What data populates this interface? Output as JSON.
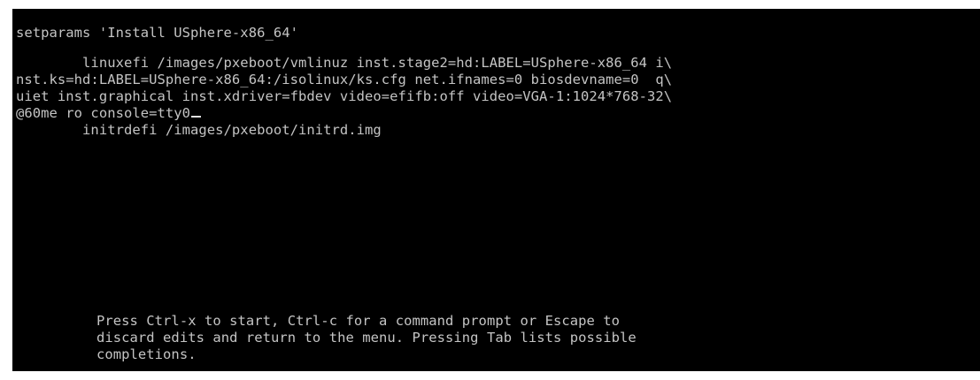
{
  "editor": {
    "lines": [
      "setparams 'Install USphere-x86_64'",
      "        linuxefi /images/pxeboot/vmlinuz inst.stage2=hd:LABEL=USphere-x86_64 i\\",
      "nst.ks=hd:LABEL=USphere-x86_64:/isolinux/ks.cfg net.ifnames=0 biosdevname=0  q\\",
      "uiet inst.graphical inst.xdriver=fbdev video=efifb:off video=VGA-1:1024*768-32\\",
      "@60me ro console=tty0",
      "        initrdefi /images/pxeboot/initrd.img"
    ]
  },
  "help": {
    "lines": [
      "Press Ctrl-x to start, Ctrl-c for a command prompt or Escape to",
      "discard edits and return to the menu. Pressing Tab lists possible",
      "completions."
    ]
  },
  "colors": {
    "background": "#000000",
    "text": "#c4c4c4"
  }
}
